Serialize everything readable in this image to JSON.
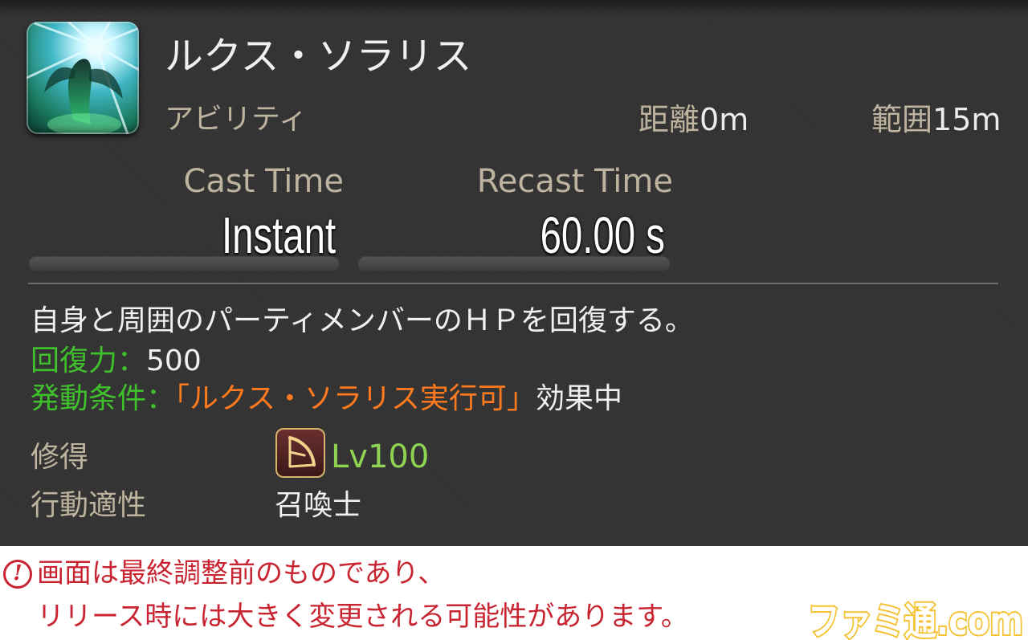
{
  "skill": {
    "name": "ルクス・ソラリス",
    "type": "アビリティ",
    "icon": "lux-solaris-icon",
    "range_label": "距離",
    "range_value": "0m",
    "radius_label": "範囲",
    "radius_value": "15m"
  },
  "timing": {
    "cast_label": "Cast Time",
    "cast_value": "Instant",
    "recast_label": "Recast Time",
    "recast_value": "60.00 s"
  },
  "description": {
    "text": "自身と周囲のパーティメンバーのＨＰを回復する。",
    "potency_label": "回復力：",
    "potency_value": "500",
    "condition_label": "発動条件：",
    "condition_status": "「ルクス・ソラリス実行可」",
    "condition_suffix": "効果中"
  },
  "meta": {
    "acquired_label": "修得",
    "job_icon": "summoner-job-icon",
    "acquired_level": "Lv100",
    "affinity_label": "行動適性",
    "affinity_value": "召喚士"
  },
  "notice": {
    "icon": "warning-icon",
    "line1": "画面は最終調整前のものであり、",
    "line2": "リリース時には大きく変更される可能性があります。",
    "watermark": "ファミ通.com"
  },
  "colors": {
    "panel_bg": "#333333",
    "label_beige": "#bdb39e",
    "effect_green": "#41c02d",
    "status_orange": "#ff7a1e",
    "level_green": "#8ed352",
    "notice_red": "#c82431",
    "watermark_yellow": "#f5c233"
  }
}
